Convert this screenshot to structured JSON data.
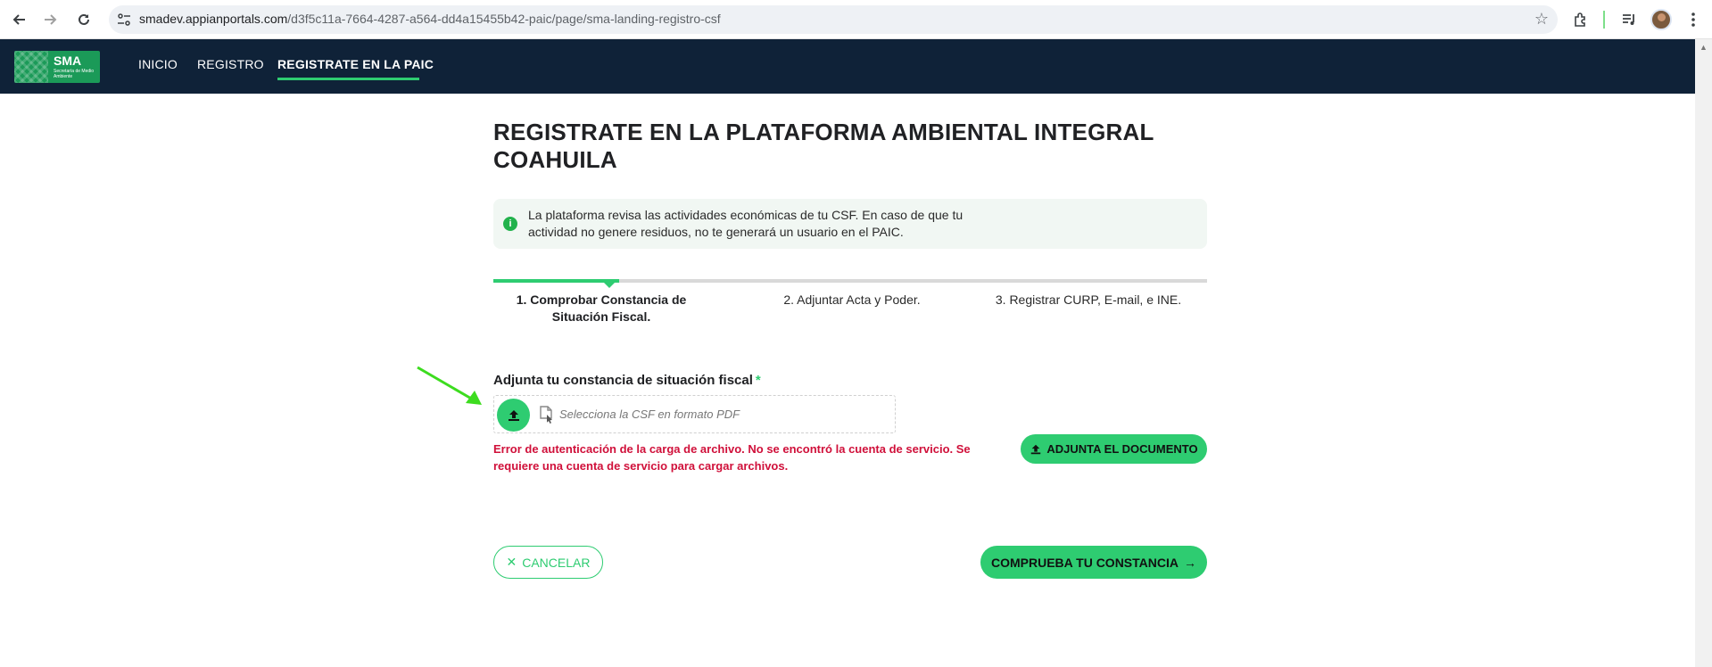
{
  "browser": {
    "url_host": "smadev.appianportals.com",
    "url_path": "/d3f5c11a-7664-4287-a564-dd4a15455b42-paic/page/sma-landing-registro-csf",
    "icons": {
      "back": "arrow-left-icon",
      "forward": "arrow-right-icon",
      "reload": "reload-icon",
      "site_info": "tune-icon",
      "bookmark": "star-icon",
      "extensions": "puzzle-icon",
      "media": "media-control-icon",
      "menu": "more-vert-icon"
    }
  },
  "header": {
    "logo_title": "SMA",
    "logo_subtitle": "Secretaría de Medio Ambiente",
    "nav": [
      {
        "label": "INICIO",
        "active": false
      },
      {
        "label": "REGISTRO",
        "active": false
      },
      {
        "label": "REGISTRATE EN LA PAIC",
        "active": true
      }
    ],
    "background": "#0f2238",
    "accent": "#2ecc71"
  },
  "main": {
    "title": "REGISTRATE EN LA PLATAFORMA AMBIENTAL INTEGRAL COAHUILA",
    "info": "La plataforma revisa las actividades económicas de tu CSF. En caso de que tu actividad no genere residuos, no te generará un usuario en el PAIC.",
    "steps": [
      {
        "label": "1. Comprobar Constancia de Situación Fiscal.",
        "current": true
      },
      {
        "label": "2. Adjuntar Acta y Poder.",
        "current": false
      },
      {
        "label": "3. Registrar CURP, E-mail, e INE.",
        "current": false
      }
    ],
    "field_label": "Adjunta tu constancia de situación fiscal",
    "required_mark": "*",
    "upload_placeholder": "Selecciona la CSF en formato PDF",
    "error": "Error de autenticación de la carga de archivo. No se encontró la cuenta de servicio. Se requiere una cuenta de servicio para cargar archivos.",
    "attach_button": "ADJUNTA EL DOCUMENTO",
    "cancel_button": "CANCELAR",
    "submit_button": "COMPRUEBA TU CONSTANCIA",
    "error_color": "#d0103a"
  }
}
